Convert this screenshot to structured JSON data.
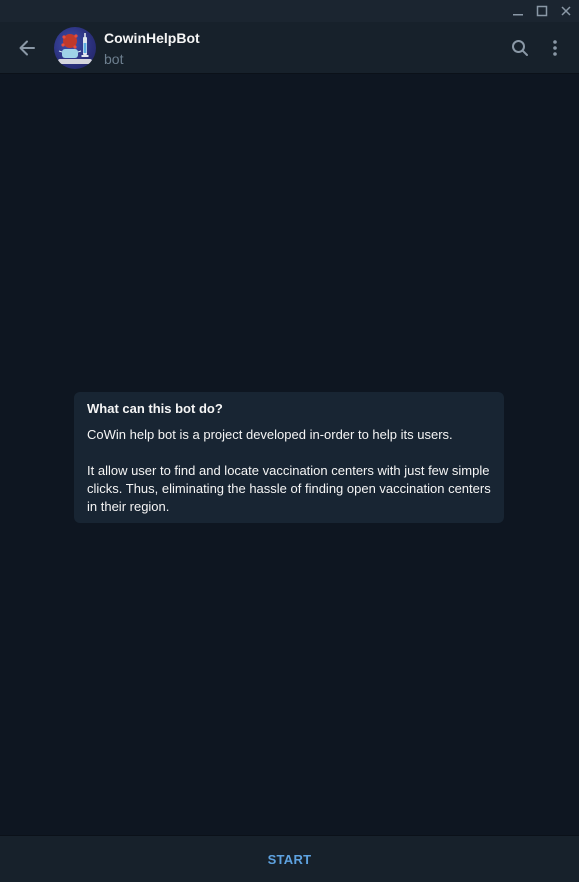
{
  "window": {
    "controls": {
      "minimize_icon": "minimize-icon",
      "maximize_icon": "maximize-icon",
      "close_icon": "close-icon"
    }
  },
  "header": {
    "back_icon": "arrow-left-icon",
    "bot_name": "CowinHelpBot",
    "bot_status": "bot",
    "search_icon": "search-icon",
    "menu_icon": "more-vertical-icon"
  },
  "info_card": {
    "title": "What can this bot do?",
    "paragraph1": "CoWin help bot is a project developed in-order to help its users.",
    "paragraph2": "It allow user to find and locate vaccination centers with just few simple clicks. Thus, eliminating the hassle of finding open vaccination centers in their region."
  },
  "footer": {
    "start_label": "START"
  },
  "colors": {
    "background": "#0e1621",
    "header": "#17212b",
    "card": "#182533",
    "accent": "#5ea2e0",
    "muted": "#6d7f8f"
  }
}
